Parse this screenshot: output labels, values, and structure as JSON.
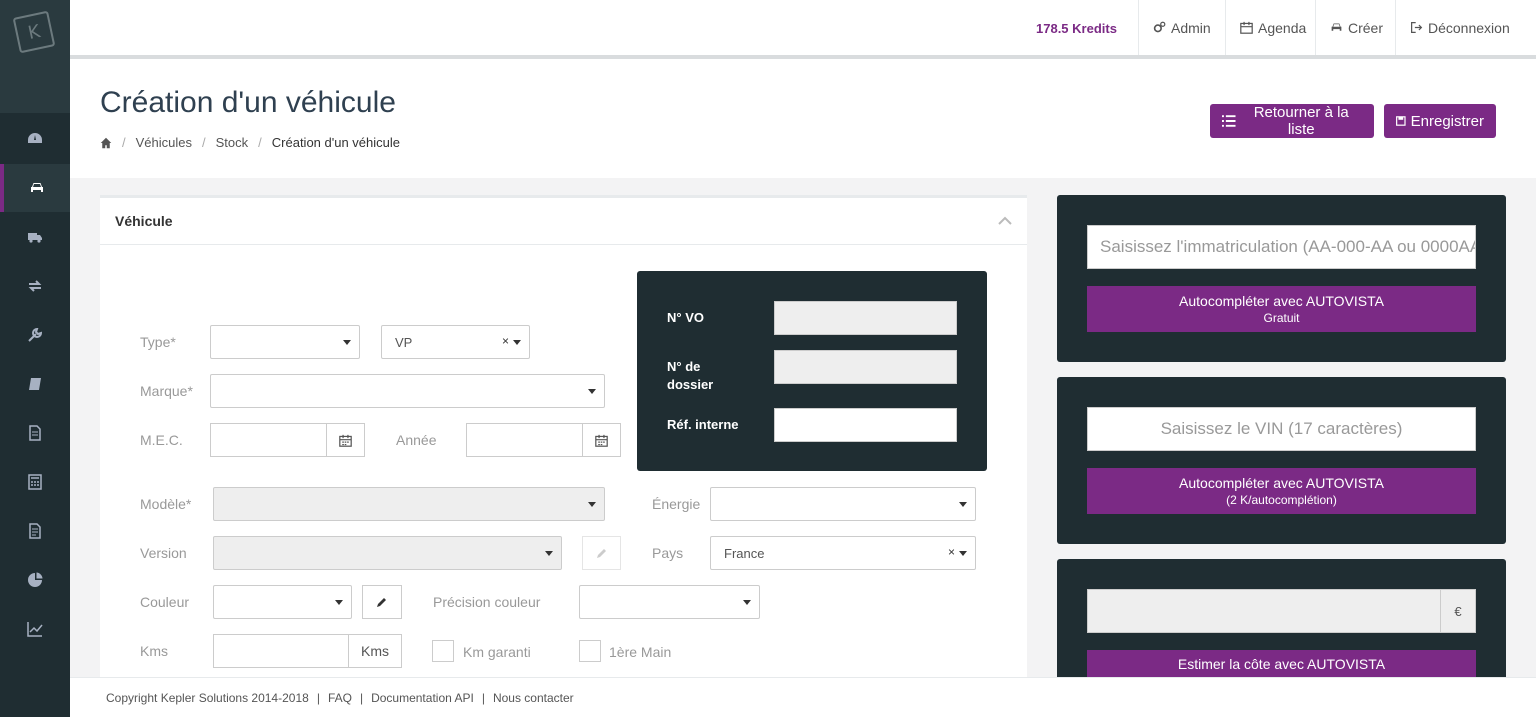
{
  "sidebar": {
    "logo_text": "K",
    "items": [
      "dashboard-icon",
      "car-icon",
      "truck-icon",
      "exchange-icon",
      "wrench-icon",
      "book-icon",
      "file-icon",
      "calculator-icon",
      "file-text-icon",
      "pie-chart-icon",
      "line-chart-icon"
    ],
    "active_index": 1
  },
  "topbar": {
    "credits": "178.5 Kredits",
    "admin": "Admin",
    "agenda": "Agenda",
    "create": "Créer",
    "logout": "Déconnexion"
  },
  "page": {
    "title": "Création d'un véhicule",
    "breadcrumb": [
      "Véhicules",
      "Stock",
      "Création d'un véhicule"
    ],
    "back_button": "Retourner à la liste",
    "save_button": "Enregistrer"
  },
  "vehicle_panel": {
    "title": "Véhicule",
    "type_label": "Type*",
    "type_value": "",
    "type2_value": "VP",
    "marque_label": "Marque*",
    "mec_label": "M.E.C.",
    "annee_label": "Année",
    "modele_label": "Modèle*",
    "energie_label": "Énergie",
    "version_label": "Version",
    "pays_label": "Pays",
    "pays_value": "France",
    "couleur_label": "Couleur",
    "precision_label": "Précision couleur",
    "kms_label": "Kms",
    "kms_unit": "Kms",
    "km_garanti": "Km garanti",
    "premiere_main": "1ère Main",
    "dark": {
      "vo_label": "N° VO",
      "dossier_label": "N° de dossier",
      "ref_label": "Réf. interne"
    }
  },
  "widgets": {
    "immat_placeholder": "Saisissez l'immatriculation (AA-000-AA ou 0000AA",
    "immat_button": "Autocompléter avec AUTOVISTA",
    "immat_button_sub": "Gratuit",
    "vin_placeholder": "Saisissez le VIN (17 caractères)",
    "vin_button": "Autocompléter avec AUTOVISTA",
    "vin_button_sub": "(2 K/autocomplétion)",
    "price_unit": "€",
    "estimate_button": "Estimer la côte avec AUTOVISTA"
  },
  "footer": {
    "copyright": "Copyright Kepler Solutions 2014-2018",
    "faq": "FAQ",
    "api": "Documentation API",
    "contact": "Nous contacter"
  },
  "colors": {
    "accent": "#7b2a85",
    "sidebar": "#1f2d32"
  }
}
